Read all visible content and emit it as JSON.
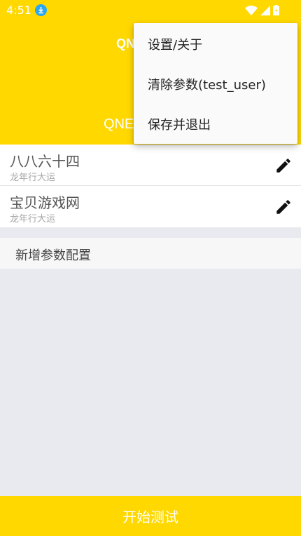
{
  "status_bar": {
    "time": "4:51",
    "icons": [
      "download-icon",
      "wifi-icon",
      "signal-icon",
      "battery-icon"
    ]
  },
  "header": {
    "title": "QN",
    "subtitle": "",
    "bottom_text": "QNE"
  },
  "list": {
    "items": [
      {
        "title": "八八六十四",
        "subtitle": "龙年行大运",
        "icon": "edit-icon"
      },
      {
        "title": "宝贝游戏网",
        "subtitle": "龙年行大运",
        "icon": "edit-icon"
      }
    ]
  },
  "add_config": {
    "label": "新增参数配置"
  },
  "start_button": {
    "label": "开始测试"
  },
  "popup_menu": {
    "items": [
      {
        "label": "设置/关于"
      },
      {
        "label": "清除参数(test_user)"
      },
      {
        "label": "保存并退出"
      }
    ]
  },
  "colors": {
    "accent": "#ffd800",
    "background": "#e9eaef",
    "download_badge": "#2ba7f0"
  }
}
